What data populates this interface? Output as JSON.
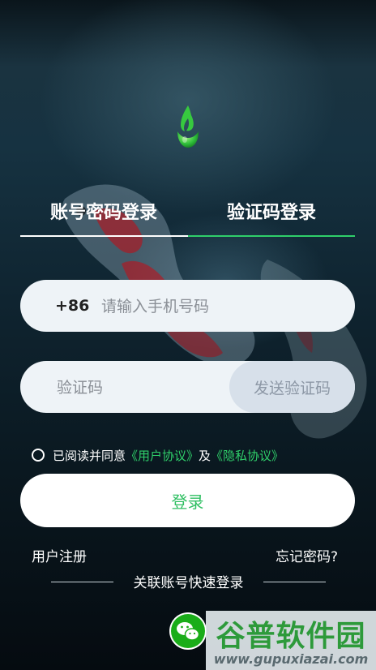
{
  "tabs": {
    "account_password": "账号密码登录",
    "verification_code": "验证码登录"
  },
  "phone": {
    "country_code": "+86",
    "placeholder": "请输入手机号码"
  },
  "code": {
    "placeholder": "验证码",
    "send_label": "发送验证码"
  },
  "agreement": {
    "prefix": "已阅读并同意",
    "user_agreement": "《用户协议》",
    "and": "及",
    "privacy": "《隐私协议》"
  },
  "login_label": "登录",
  "register_label": "用户注册",
  "forgot_label": "忘记密码?",
  "quick_login_label": "关联账号快速登录",
  "watermark": {
    "title": "谷普软件园",
    "url": "www.gupuxiazai.com"
  },
  "colors": {
    "accent": "#2fcf6a",
    "field_bg": "#eef3f7",
    "send_bg": "#d7e0ea"
  },
  "icons": {
    "logo": "green-drop-logo-icon",
    "wechat": "wechat-icon"
  }
}
